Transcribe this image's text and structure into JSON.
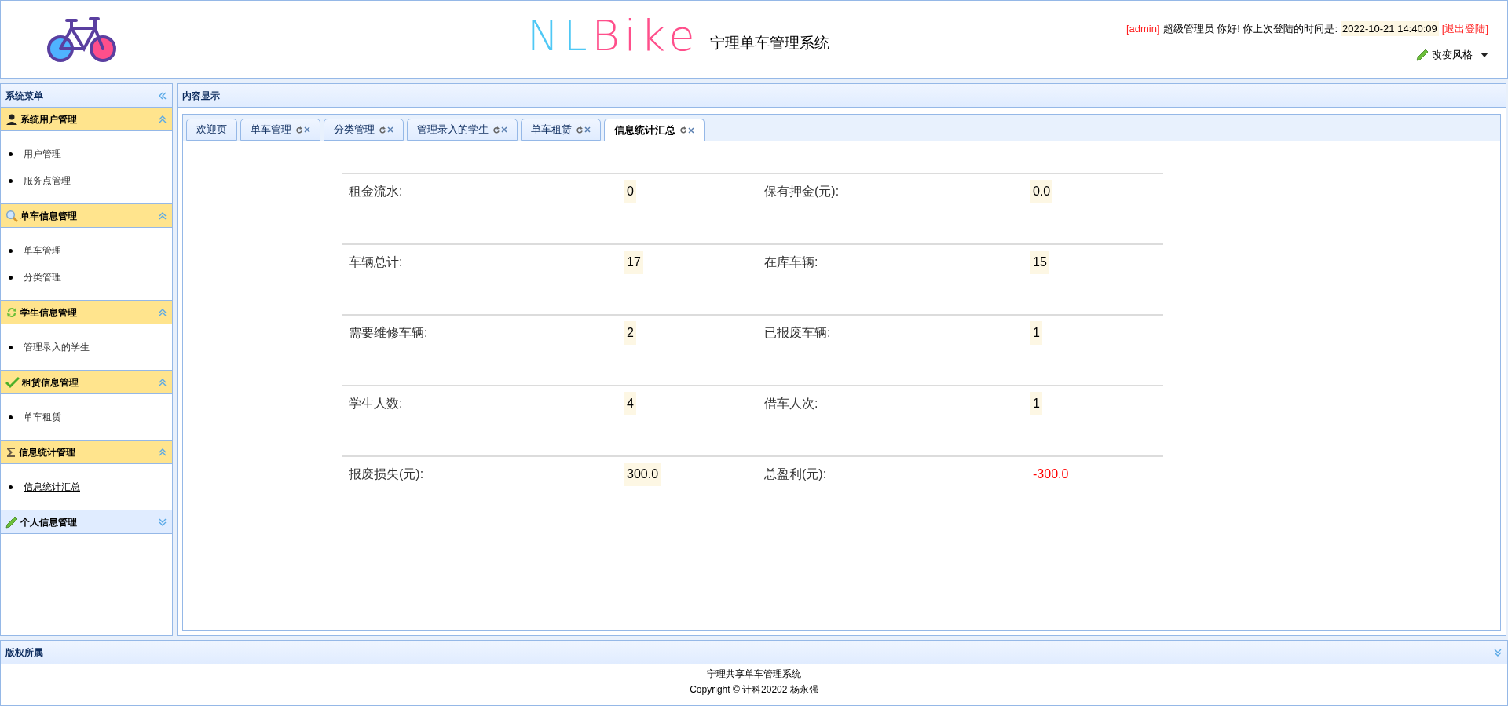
{
  "header": {
    "logo_text": "NLBike",
    "system_name": "宁理单车管理系统",
    "user_tag": "[admin]",
    "greeting": "超级管理员 你好! 你上次登陆的时间是:",
    "last_login": "2022-10-21 14:40:09",
    "logout": "[退出登陆]",
    "style_menu": "改变风格"
  },
  "sidebar": {
    "title": "系统菜单",
    "groups": [
      {
        "title": "系统用户管理",
        "expanded": true,
        "items": [
          {
            "label": "用户管理",
            "selected": false
          },
          {
            "label": "服务点管理",
            "selected": false
          }
        ]
      },
      {
        "title": "单车信息管理",
        "expanded": true,
        "items": [
          {
            "label": "单车管理",
            "selected": false
          },
          {
            "label": "分类管理",
            "selected": false
          }
        ]
      },
      {
        "title": "学生信息管理",
        "expanded": true,
        "items": [
          {
            "label": "管理录入的学生",
            "selected": false
          }
        ]
      },
      {
        "title": "租赁信息管理",
        "expanded": true,
        "items": [
          {
            "label": "单车租赁",
            "selected": false
          }
        ]
      },
      {
        "title": "信息统计管理",
        "expanded": true,
        "items": [
          {
            "label": "信息统计汇总",
            "selected": true
          }
        ]
      },
      {
        "title": "个人信息管理",
        "expanded": false
      }
    ]
  },
  "content": {
    "title": "内容显示",
    "tabs": [
      {
        "label": "欢迎页",
        "selected": false,
        "closable": false
      },
      {
        "label": "单车管理",
        "selected": false,
        "closable": true
      },
      {
        "label": "分类管理",
        "selected": false,
        "closable": true
      },
      {
        "label": "管理录入的学生",
        "selected": false,
        "closable": true
      },
      {
        "label": "单车租赁",
        "selected": false,
        "closable": true
      },
      {
        "label": "信息统计汇总",
        "selected": true,
        "closable": true
      }
    ],
    "stats": [
      [
        {
          "label": "租金流水:",
          "value": "0",
          "kind": "highlight"
        },
        {
          "label": "保有押金(元):",
          "value": "0.0",
          "kind": "highlight"
        }
      ],
      [
        {
          "label": "车辆总计:",
          "value": "17",
          "kind": "highlight"
        },
        {
          "label": "在库车辆:",
          "value": "15",
          "kind": "highlight"
        }
      ],
      [
        {
          "label": "需要维修车辆:",
          "value": "2",
          "kind": "highlight"
        },
        {
          "label": "已报废车辆:",
          "value": "1",
          "kind": "highlight"
        }
      ],
      [
        {
          "label": "学生人数:",
          "value": "4",
          "kind": "highlight"
        },
        {
          "label": "借车人次:",
          "value": "1",
          "kind": "highlight"
        }
      ],
      [
        {
          "label": "报废损失(元):",
          "value": "300.0",
          "kind": "highlight"
        },
        {
          "label": "总盈利(元):",
          "value": "-300.0",
          "kind": "alert"
        }
      ]
    ]
  },
  "footer": {
    "title": "版权所属",
    "lines": [
      "宁理共享单车管理系统",
      "Copyright © 计科20202 杨永强"
    ]
  }
}
